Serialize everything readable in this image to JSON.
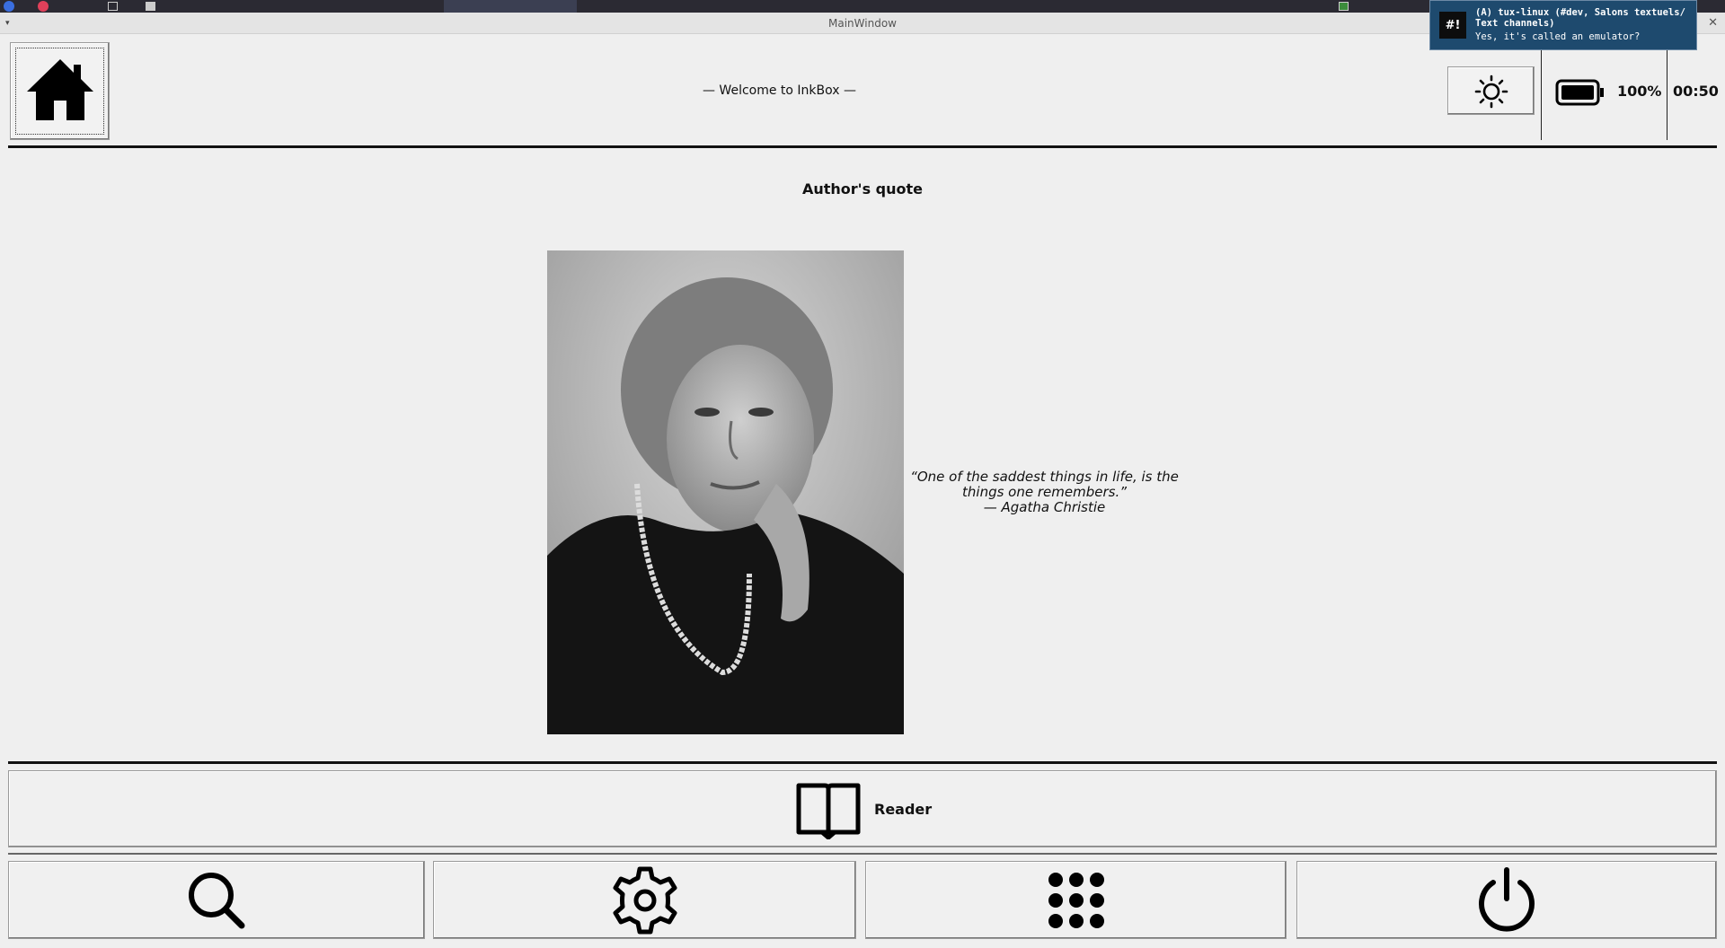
{
  "window": {
    "title": "MainWindow",
    "menu_glyph": "▾",
    "close_glyph": "✕"
  },
  "notification": {
    "icon_text": "#!",
    "title": "(A) tux-linux (#dev, Salons textuels/ Text channels)",
    "body": "Yes, it's called an emulator?"
  },
  "header": {
    "home_icon": "home-icon",
    "welcome": "— Welcome to InkBox —",
    "brightness_icon": "sun-icon",
    "battery_icon": "battery-full-icon",
    "battery_level": "100%",
    "clock": "00:50"
  },
  "content": {
    "section_title": "Author's quote",
    "portrait_subject": "Agatha Christie",
    "quote_lines": [
      "“One of the saddest things in life, is the",
      "things one remembers.”",
      "— Agatha Christie"
    ]
  },
  "reader": {
    "icon": "book-icon",
    "label": "Reader"
  },
  "bottom_bar": {
    "buttons": [
      {
        "icon": "search-icon"
      },
      {
        "icon": "settings-gear-icon"
      },
      {
        "icon": "apps-grid-icon"
      },
      {
        "icon": "power-icon"
      }
    ]
  },
  "colors": {
    "background": "#efefef",
    "foreground": "#111111",
    "notification_bg": "#1e4a6e"
  }
}
